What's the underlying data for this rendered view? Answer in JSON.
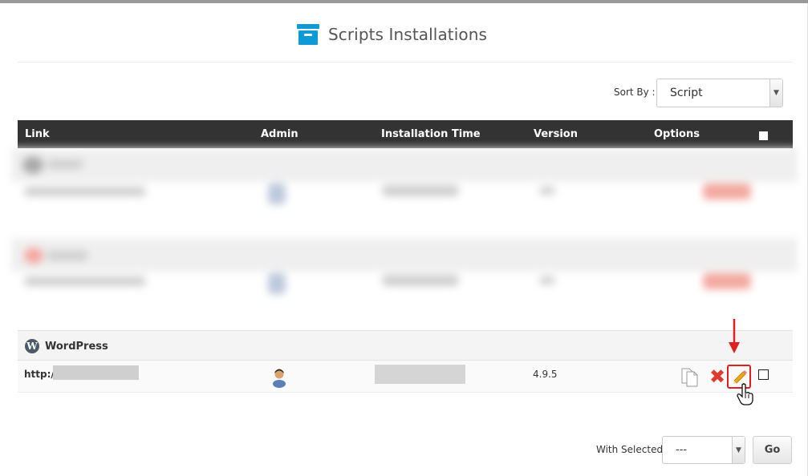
{
  "header": {
    "title": "Scripts Installations",
    "icon": "archive-box-icon",
    "accent": "#0d9ad6"
  },
  "sort": {
    "label": "Sort By :",
    "selected": "Script"
  },
  "table": {
    "columns": [
      "Link",
      "Admin",
      "Installation Time",
      "Version",
      "Options"
    ],
    "header_bg": "#333333",
    "groups": [
      {
        "script": "WordPress",
        "icon": "wordpress-icon",
        "installations": [
          {
            "link": "http://",
            "version": "4.9.5",
            "options": [
              "clone-icon",
              "remove-icon",
              "edit-icon"
            ]
          }
        ]
      }
    ]
  },
  "bulk": {
    "label": "With Selected:",
    "selected": "---",
    "go_label": "Go"
  },
  "annotation": {
    "arrow_color": "#e02020"
  }
}
